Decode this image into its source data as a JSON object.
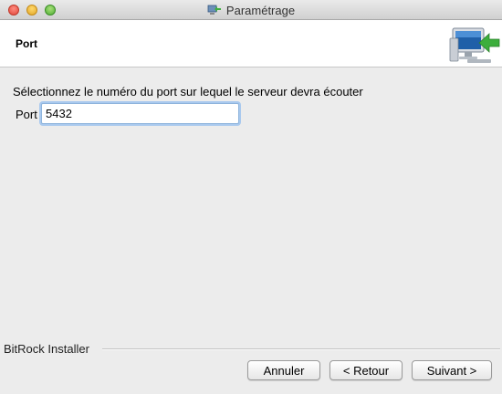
{
  "window": {
    "title": "Paramétrage"
  },
  "header": {
    "title": "Port",
    "logo_icon": "installer-computer-icon"
  },
  "main": {
    "instruction": "Sélectionnez le numéro du port sur lequel le serveur devra écouter",
    "port_label": "Port",
    "port_value": "5432"
  },
  "footer": {
    "installer_label": "BitRock Installer",
    "cancel_label": "Annuler",
    "back_label": "< Retour",
    "next_label": "Suivant >"
  },
  "colors": {
    "focus_ring": "#a9c9ee",
    "header_background": "#ffffff",
    "window_background": "#ececec"
  }
}
